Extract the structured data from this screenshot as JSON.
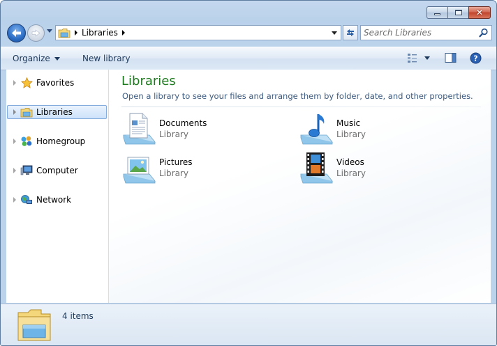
{
  "window": {
    "controls": {
      "minimize_icon": "minimize-icon",
      "maximize_icon": "maximize-icon",
      "close_icon": "close-icon",
      "close_glyph": "✕"
    }
  },
  "nav": {
    "address_segments": [
      "Libraries"
    ],
    "search_placeholder": "Search Libraries"
  },
  "toolbar": {
    "organize_label": "Organize",
    "new_library_label": "New library"
  },
  "tree": {
    "items": [
      {
        "label": "Favorites",
        "icon": "star-icon"
      },
      {
        "label": "Libraries",
        "icon": "libraries-icon",
        "selected": true
      },
      {
        "label": "Homegroup",
        "icon": "homegroup-icon"
      },
      {
        "label": "Computer",
        "icon": "computer-icon"
      },
      {
        "label": "Network",
        "icon": "network-icon"
      }
    ]
  },
  "main": {
    "title": "Libraries",
    "subtitle": "Open a library to see your files and arrange them by folder, date, and other properties.",
    "libraries": [
      {
        "name": "Documents",
        "type": "Library",
        "icon": "documents-library-icon"
      },
      {
        "name": "Music",
        "type": "Library",
        "icon": "music-library-icon"
      },
      {
        "name": "Pictures",
        "type": "Library",
        "icon": "pictures-library-icon"
      },
      {
        "name": "Videos",
        "type": "Library",
        "icon": "videos-library-icon"
      }
    ]
  },
  "details": {
    "item_count": "4 items"
  },
  "colors": {
    "title_green": "#1e7a1e",
    "nav_text": "#1e395b",
    "selection": "#cde2fa"
  }
}
